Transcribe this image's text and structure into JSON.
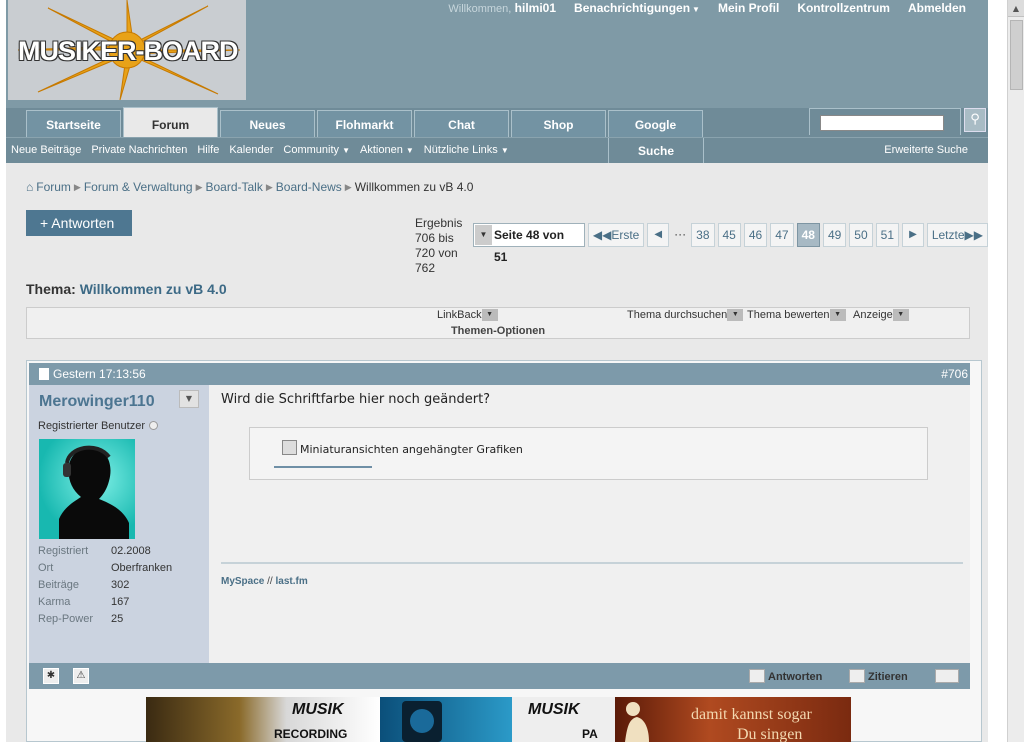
{
  "header": {
    "logo_text": "MUSIKER-BOARD",
    "welcome": "Willkommen,",
    "username": "hilmi01",
    "links": [
      {
        "label": "Benachrichtigungen",
        "dropdown": true
      },
      {
        "label": "Mein Profil",
        "dropdown": false
      },
      {
        "label": "Kontrollzentrum",
        "dropdown": false
      },
      {
        "label": "Abmelden",
        "dropdown": false
      }
    ]
  },
  "nav": {
    "tabs": [
      {
        "label": "Startseite",
        "active": false
      },
      {
        "label": "Forum",
        "active": true
      },
      {
        "label": "Neues",
        "active": false
      },
      {
        "label": "Flohmarkt",
        "active": false
      },
      {
        "label": "Chat",
        "active": false
      },
      {
        "label": "Shop",
        "active": false
      },
      {
        "label": "Google",
        "active": false
      }
    ],
    "search_placeholder": "",
    "search_icon": "magnifier-icon",
    "subnav": [
      {
        "label": "Neue Beiträge",
        "dropdown": false
      },
      {
        "label": "Private Nachrichten",
        "dropdown": false
      },
      {
        "label": "Hilfe",
        "dropdown": false
      },
      {
        "label": "Kalender",
        "dropdown": false
      },
      {
        "label": "Community",
        "dropdown": true
      },
      {
        "label": "Aktionen",
        "dropdown": true
      },
      {
        "label": "Nützliche Links",
        "dropdown": true
      }
    ],
    "search_tab": "Suche",
    "advanced_search": "Erweiterte Suche"
  },
  "breadcrumb": {
    "items": [
      "Forum",
      "Forum & Verwaltung",
      "Board-Talk",
      "Board-News"
    ],
    "current": "Willkommen zu vB 4.0"
  },
  "thread": {
    "reply_label": "+ Antworten",
    "result_info": "Ergebnis 706 bis 720 von 762",
    "page_select": "Seite 48 von 51",
    "first_label": "Erste",
    "last_label": "Letzte",
    "pages_before": [
      "38",
      "45",
      "46",
      "47"
    ],
    "current_page": "48",
    "pages_after": [
      "49",
      "50",
      "51"
    ],
    "dots": "···",
    "title_prefix": "Thema:",
    "title": "Willkommen zu vB 4.0"
  },
  "options": {
    "linkback": "LinkBack",
    "search_thread": "Thema durchsuchen",
    "rate_thread": "Thema bewerten",
    "display": "Anzeige",
    "title": "Themen-Optionen"
  },
  "post": {
    "date": "Gestern 17:13:56",
    "number": "#706",
    "author": "Merowinger110",
    "user_title": "Registrierter Benutzer",
    "stats": [
      {
        "key": "Registriert",
        "value": "02.2008"
      },
      {
        "key": "Ort",
        "value": "Oberfranken"
      },
      {
        "key": "Beiträge",
        "value": "302"
      },
      {
        "key": "Karma",
        "value": "167"
      },
      {
        "key": "Rep-Power",
        "value": "25"
      }
    ],
    "text": "Wird die Schriftfarbe hier noch geändert?",
    "attachment_label": "Miniaturansichten angehängter Grafiken",
    "signature": {
      "link1": "MySpace",
      "sep": "//",
      "link2": "last.fm"
    },
    "reply_button": "Antworten",
    "quote_button": "Zitieren"
  },
  "banner": {
    "brand1": "MUSIK",
    "sub1": "RECORDING",
    "brand2": "MUSIK",
    "sub2": "PA",
    "slogan1": "damit kannst sogar",
    "slogan2": "Du singen"
  },
  "colors": {
    "header_bg": "#7f9aa6",
    "nav_bg": "#6f8b98",
    "link": "#4a6f86",
    "post_head": "#7d9aaa"
  }
}
